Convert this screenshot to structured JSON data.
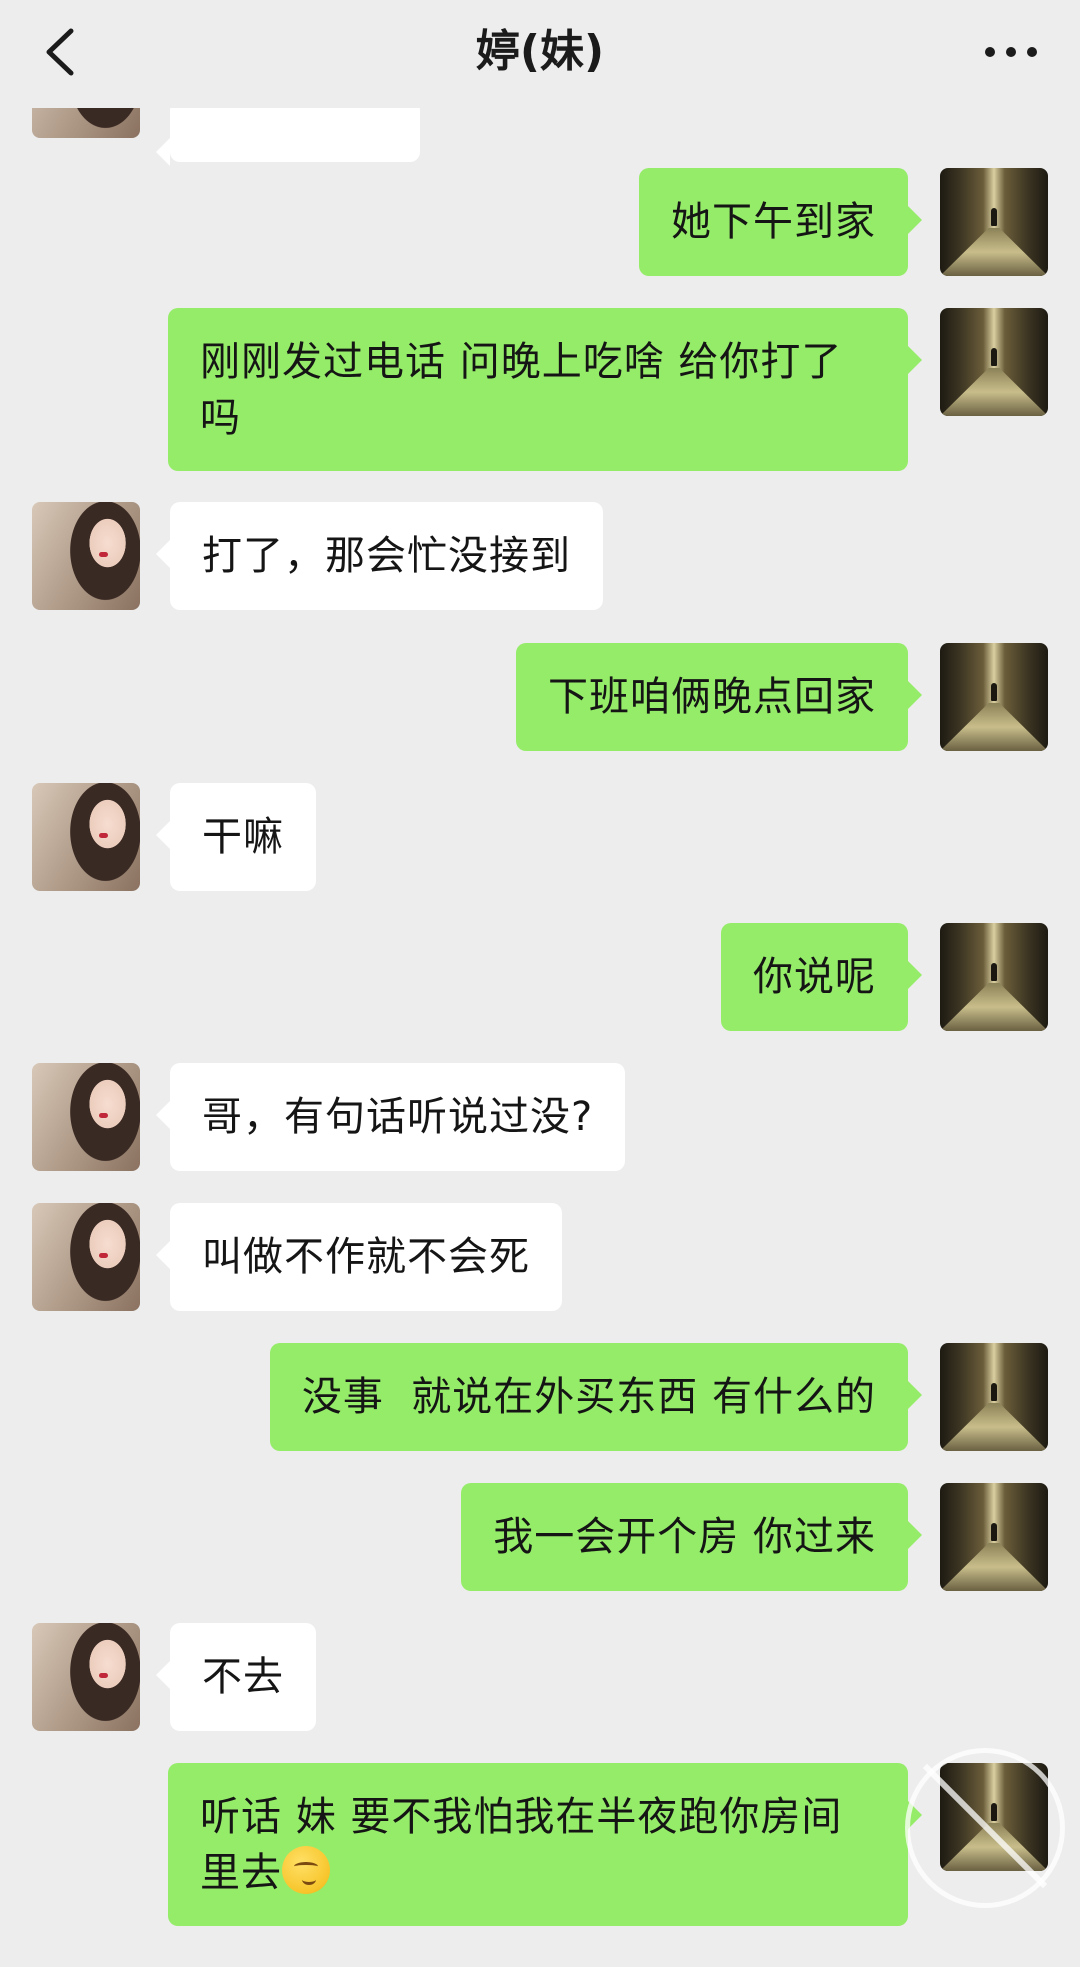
{
  "header": {
    "title": "婷(妹)",
    "back_icon": "chevron-left-icon",
    "more_icon": "more-dots-icon"
  },
  "messages": [
    {
      "side": "sent",
      "text": "她下午到家"
    },
    {
      "side": "sent",
      "text": "刚刚发过电话 问晚上吃啥 给你打了吗"
    },
    {
      "side": "recv",
      "text": "打了，那会忙没接到"
    },
    {
      "side": "sent",
      "text": "下班咱俩晚点回家"
    },
    {
      "side": "recv",
      "text": "干嘛"
    },
    {
      "side": "sent",
      "text": "你说呢"
    },
    {
      "side": "recv",
      "text": "哥，有句话听说过没?"
    },
    {
      "side": "recv",
      "text": "叫做不作就不会死"
    },
    {
      "side": "sent",
      "text": "没事  就说在外买东西 有什么的"
    },
    {
      "side": "sent",
      "text": "我一会开个房 你过来"
    },
    {
      "side": "recv",
      "text": "不去"
    },
    {
      "side": "sent",
      "text": "听话 妹 要不我怕我在半夜跑你房间里去",
      "emoji": "thinking-face-emoji"
    }
  ],
  "colors": {
    "background": "#ededed",
    "sent_bubble": "#95ec69",
    "recv_bubble": "#ffffff"
  }
}
